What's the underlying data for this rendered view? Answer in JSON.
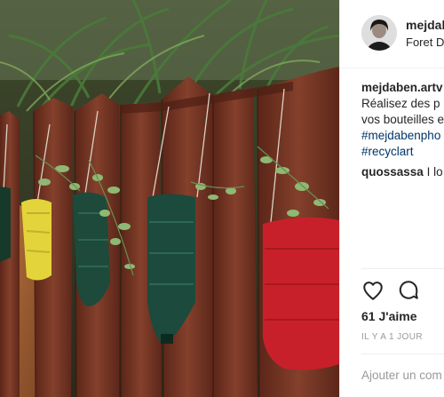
{
  "post": {
    "username": "mejdal",
    "location": "Foret D",
    "caption": {
      "username": "mejdaben.artv",
      "lines": [
        "Réalisez des p",
        "vos bouteilles e"
      ],
      "hashtags": [
        "#mejdabenpho",
        "#recyclart"
      ]
    },
    "comment": {
      "username": "quossassa",
      "text": "I lo"
    },
    "likes": "61 J'aime",
    "timestamp": "IL Y A 1 JOUR",
    "add_comment_placeholder": "Ajouter un com"
  },
  "colors": {
    "hashtag": "#003569",
    "muted": "#999999",
    "text": "#262626"
  },
  "icons": [
    "heart-icon",
    "comment-icon"
  ]
}
